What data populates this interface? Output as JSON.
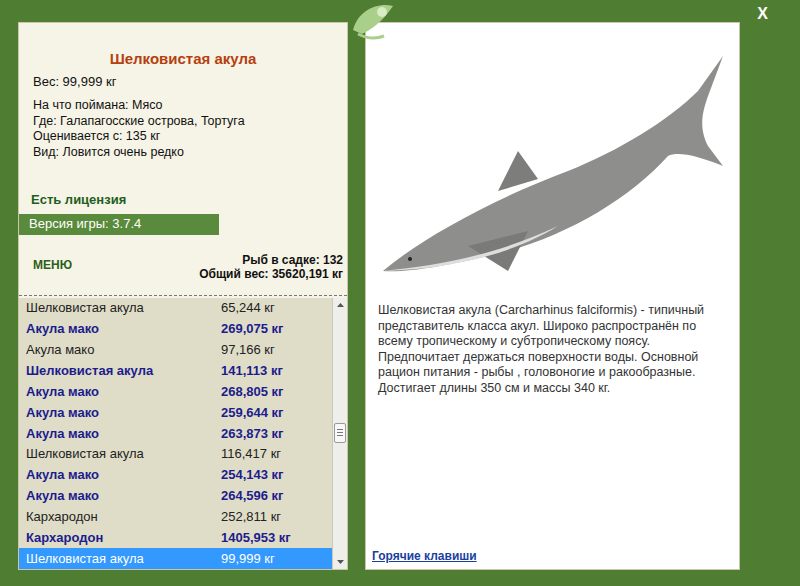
{
  "window": {
    "close": "X"
  },
  "fish": {
    "name": "Шелковистая акула",
    "weight": "Вес: 99,999 кг",
    "details": [
      "На что поймана: Мясо",
      "Где: Галапагосские острова, Тортуга",
      "Оценивается с: 135 кг",
      "Вид: Ловится очень редко"
    ]
  },
  "license": "Есть лицензия",
  "version": "Версия игры: 3.7.4",
  "menu": "МЕНЮ",
  "cage_count": "Рыб в садке: 132",
  "total_weight": "Общий вес: 35620,191 кг",
  "catch_list": {
    "scroll_position": 0.55,
    "rows": [
      {
        "name": "Шелковистая акула",
        "weight": "65,244 кг",
        "trophy": false,
        "selected": false
      },
      {
        "name": "Акула мако",
        "weight": "269,075 кг",
        "trophy": true,
        "selected": false
      },
      {
        "name": "Акула мако",
        "weight": "97,166 кг",
        "trophy": false,
        "selected": false
      },
      {
        "name": "Шелковистая акула",
        "weight": "141,113 кг",
        "trophy": true,
        "selected": false
      },
      {
        "name": "Акула мако",
        "weight": "268,805 кг",
        "trophy": true,
        "selected": false
      },
      {
        "name": "Акула мако",
        "weight": "259,644 кг",
        "trophy": true,
        "selected": false
      },
      {
        "name": "Акула мако",
        "weight": "263,873 кг",
        "trophy": true,
        "selected": false
      },
      {
        "name": "Шелковистая акула",
        "weight": "116,417 кг",
        "trophy": false,
        "selected": false
      },
      {
        "name": "Акула мако",
        "weight": "254,143 кг",
        "trophy": true,
        "selected": false
      },
      {
        "name": "Акула мако",
        "weight": "264,596 кг",
        "trophy": true,
        "selected": false
      },
      {
        "name": "Кархародон",
        "weight": "252,811 кг",
        "trophy": false,
        "selected": false
      },
      {
        "name": "Кархародон",
        "weight": "1405,953 кг",
        "trophy": true,
        "selected": false
      },
      {
        "name": "Шелковистая акула",
        "weight": "99,999 кг",
        "trophy": false,
        "selected": true
      }
    ]
  },
  "description": "Шелковистая акула (Carcharhinus falciformis) - типичный представитель класса акул. Широко распространён по всему тропическому и субтропическому поясу. Предпочитает держаться поверхности воды. Основной рацион питания - рыбы , головоногие и ракообразные. Достигает длины 350 см и массы 340 кг.",
  "hotkeys_link": "Горячие клавиши"
}
